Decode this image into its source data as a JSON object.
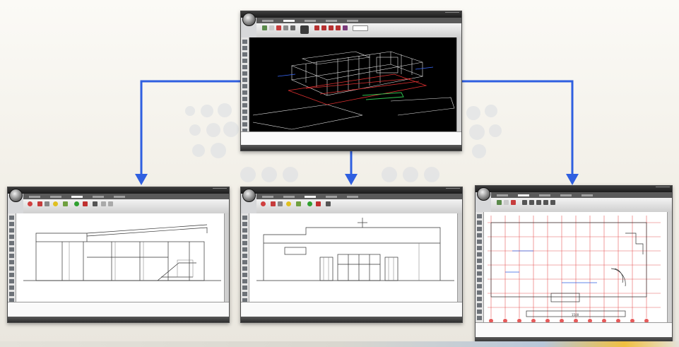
{
  "diagram": {
    "description_nodes": [
      {
        "id": "model-3d",
        "view": "3d-wireframe"
      },
      {
        "id": "elevation-side",
        "view": "side-elevation"
      },
      {
        "id": "elevation-front",
        "view": "front-elevation"
      },
      {
        "id": "floor-plan",
        "view": "floor-plan"
      }
    ],
    "arrow_color": "#2f5fe0"
  },
  "windows": {
    "plan_sign": "1500"
  },
  "colors": {
    "arrow": "#2f5fe0",
    "grid_lines": "#e65a5a",
    "dark_canvas": "#000000",
    "wire": "#e8e8e8"
  }
}
